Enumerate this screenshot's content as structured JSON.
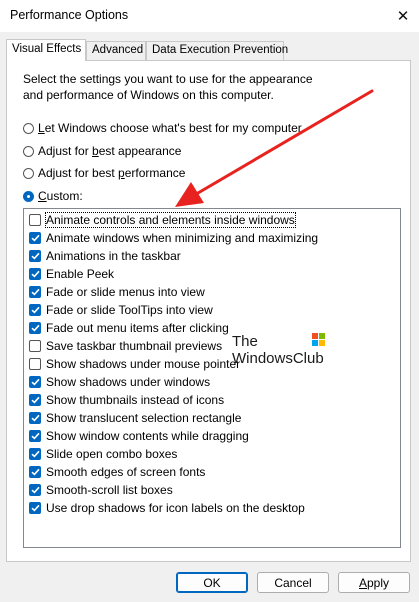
{
  "window": {
    "title": "Performance Options",
    "close_label": "✕"
  },
  "tabs": [
    {
      "label": "Visual Effects",
      "active": true
    },
    {
      "label": "Advanced",
      "active": false
    },
    {
      "label": "Data Execution Prevention",
      "active": false
    }
  ],
  "description": "Select the settings you want to use for the appearance and performance of Windows on this computer.",
  "radios": [
    {
      "pre": "",
      "ul": "L",
      "post": "et Windows choose what's best for my computer",
      "selected": false
    },
    {
      "pre": "Adjust for ",
      "ul": "b",
      "post": "est appearance",
      "selected": false
    },
    {
      "pre": "Adjust for best ",
      "ul": "p",
      "post": "erformance",
      "selected": false
    },
    {
      "pre": "",
      "ul": "C",
      "post": "ustom:",
      "selected": true
    }
  ],
  "settings": [
    {
      "label": "Animate controls and elements inside windows",
      "checked": false,
      "focused": true
    },
    {
      "label": "Animate windows when minimizing and maximizing",
      "checked": true
    },
    {
      "label": "Animations in the taskbar",
      "checked": true
    },
    {
      "label": "Enable Peek",
      "checked": true
    },
    {
      "label": "Fade or slide menus into view",
      "checked": true
    },
    {
      "label": "Fade or slide ToolTips into view",
      "checked": true
    },
    {
      "label": "Fade out menu items after clicking",
      "checked": true
    },
    {
      "label": "Save taskbar thumbnail previews",
      "checked": false
    },
    {
      "label": "Show shadows under mouse pointer",
      "checked": false
    },
    {
      "label": "Show shadows under windows",
      "checked": true
    },
    {
      "label": "Show thumbnails instead of icons",
      "checked": true
    },
    {
      "label": "Show translucent selection rectangle",
      "checked": true
    },
    {
      "label": "Show window contents while dragging",
      "checked": true
    },
    {
      "label": "Slide open combo boxes",
      "checked": true
    },
    {
      "label": "Smooth edges of screen fonts",
      "checked": true
    },
    {
      "label": "Smooth-scroll list boxes",
      "checked": true
    },
    {
      "label": "Use drop shadows for icon labels on the desktop",
      "checked": true
    }
  ],
  "watermark": {
    "line1": "The",
    "line2": "WindowsClub"
  },
  "buttons": {
    "ok": "OK",
    "cancel": "Cancel",
    "apply_pre": "",
    "apply_ul": "A",
    "apply_post": "pply"
  },
  "colors": {
    "accent": "#0067c0",
    "annotation_arrow": "#e8231f"
  }
}
